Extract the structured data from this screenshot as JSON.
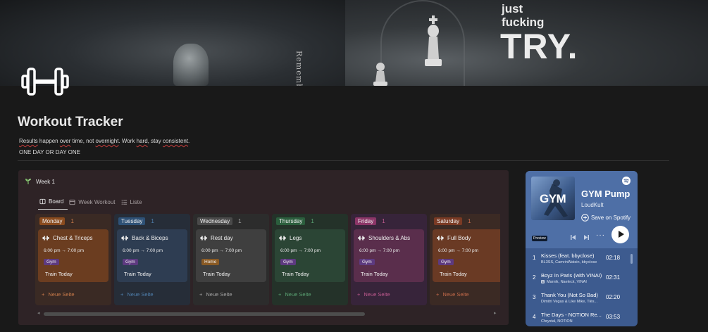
{
  "cover": {
    "side_word": "Rememb",
    "line1": "just",
    "line2": "fucking",
    "line3": "TRY."
  },
  "page": {
    "title": "Workout Tracker",
    "subtitle_parts": [
      "Results",
      " happen ",
      "over",
      " time, not ",
      "overnight",
      ". Work ",
      "hard",
      ", stay ",
      "consistent",
      "."
    ],
    "motto": "ONE DAY OR DAY ONE"
  },
  "board": {
    "view_name": "Week 1",
    "tabs": [
      {
        "label": "Board",
        "icon": "board-icon",
        "active": true
      },
      {
        "label": "Week Workout",
        "icon": "calendar-icon",
        "active": false
      },
      {
        "label": "Liste",
        "icon": "list-icon",
        "active": false
      }
    ],
    "new_page_label": "Neue Seite",
    "columns": [
      {
        "day": "Monday",
        "count": "1",
        "workout": "Chest & Triceps",
        "time": "6:00 pm → 7:00 pm",
        "tag": "Gym",
        "action": "Train Today",
        "col_bg": "#3a2a24",
        "pill": "#8a4b1e",
        "card_bg": "#6b3d20",
        "tag_bg": "#5d3a80",
        "accent": "#c87a4a"
      },
      {
        "day": "Tuesday",
        "count": "1",
        "workout": "Back & Biceps",
        "time": "6:00 pm → 7:00 pm",
        "tag": "Gym",
        "action": "Train Today",
        "col_bg": "#262d38",
        "pill": "#2e5176",
        "card_bg": "#2e3d52",
        "tag_bg": "#5d3a80",
        "accent": "#4f7fad"
      },
      {
        "day": "Wednesday",
        "count": "1",
        "workout": "Rest day",
        "time": "6:00 pm → 7:00 pm",
        "tag": "Home",
        "action": "Train Today",
        "col_bg": "#2c2c2c",
        "pill": "#4a4a4a",
        "card_bg": "#3f3f3f",
        "tag_bg": "#8a5a24",
        "accent": "#a3a3a3"
      },
      {
        "day": "Thursday",
        "count": "1",
        "workout": "Legs",
        "time": "6:00 pm → 7:00 pm",
        "tag": "Gym",
        "action": "Train Today",
        "col_bg": "#243229",
        "pill": "#2b5e3d",
        "card_bg": "#2b4535",
        "tag_bg": "#5d3a80",
        "accent": "#5aa272"
      },
      {
        "day": "Friday",
        "count": "1",
        "workout": "Shoulders & Abs",
        "time": "6:00 pm → 7:00 pm",
        "tag": "Gym",
        "action": "Train Today",
        "col_bg": "#37243a",
        "pill": "#8b3567",
        "card_bg": "#5a2e4c",
        "tag_bg": "#5d3a80",
        "accent": "#c05a8f"
      },
      {
        "day": "Saturday",
        "count": "1",
        "workout": "Full Body",
        "time": "6:00 pm → 7:00 pm",
        "tag": "Gym",
        "action": "Train Today",
        "col_bg": "#3b2a24",
        "pill": "#7a3a24",
        "card_bg": "#6a3a24",
        "tag_bg": "#5d3a80",
        "accent": "#c46a4a"
      }
    ]
  },
  "spotify": {
    "album_label": "GYM",
    "title": "GYM Pump",
    "artist": "LoudKult",
    "save_label": "Save on Spotify",
    "preview_label": "Preview",
    "more_label": "···",
    "tracks": [
      {
        "num": "1",
        "name": "Kisses (feat. bbyclose)",
        "artists": "BL3SS, CamrinWatsin, bbyclose",
        "duration": "02:18",
        "explicit": false
      },
      {
        "num": "2",
        "name": "Boyz In Paris (with VINAI)",
        "artists": "Marnik, Naeleck, VINAI",
        "duration": "02:31",
        "explicit": true,
        "explicit_label": "E"
      },
      {
        "num": "3",
        "name": "Thank You (Not So Bad)",
        "artists": "Dimitri Vegas & Like Mike, Tiës...",
        "duration": "02:20",
        "explicit": false
      },
      {
        "num": "4",
        "name": "The Days - NOTION Re...",
        "artists": "Chrystal, NOTION",
        "duration": "03:53",
        "explicit": false
      }
    ]
  },
  "colors": {
    "background": "#191919",
    "panel": "#2e2326",
    "spotify_bg": "#3d5b8f"
  }
}
